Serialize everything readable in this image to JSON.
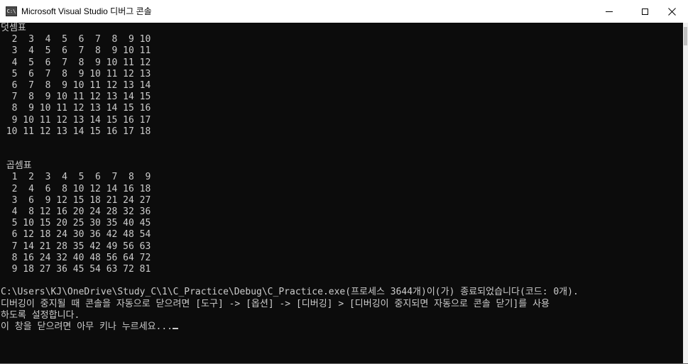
{
  "window": {
    "icon_text": "C:\\",
    "title": "Microsoft Visual Studio 디버그 콘솔"
  },
  "console": {
    "lines": [
      "덧셈표",
      "  2  3  4  5  6  7  8  9 10",
      "  3  4  5  6  7  8  9 10 11",
      "  4  5  6  7  8  9 10 11 12",
      "  5  6  7  8  9 10 11 12 13",
      "  6  7  8  9 10 11 12 13 14",
      "  7  8  9 10 11 12 13 14 15",
      "  8  9 10 11 12 13 14 15 16",
      "  9 10 11 12 13 14 15 16 17",
      " 10 11 12 13 14 15 16 17 18",
      "",
      "",
      " 곱셈표",
      "  1  2  3  4  5  6  7  8  9",
      "  2  4  6  8 10 12 14 16 18",
      "  3  6  9 12 15 18 21 24 27",
      "  4  8 12 16 20 24 28 32 36",
      "  5 10 15 20 25 30 35 40 45",
      "  6 12 18 24 30 36 42 48 54",
      "  7 14 21 28 35 42 49 56 63",
      "  8 16 24 32 40 48 56 64 72",
      "  9 18 27 36 45 54 63 72 81",
      "",
      "C:\\Users\\KJ\\OneDrive\\Study_C\\1\\C_Practice\\Debug\\C_Practice.exe(프로세스 3644개)이(가) 종료되었습니다(코드: 0개).",
      "디버깅이 중지될 때 콘솔을 자동으로 닫으려면 [도구] -> [옵션] -> [디버깅] > [디버깅이 중지되면 자동으로 콘솔 닫기]를 사용",
      "하도록 설정합니다.",
      "이 창을 닫으려면 아무 키나 누르세요..."
    ]
  }
}
